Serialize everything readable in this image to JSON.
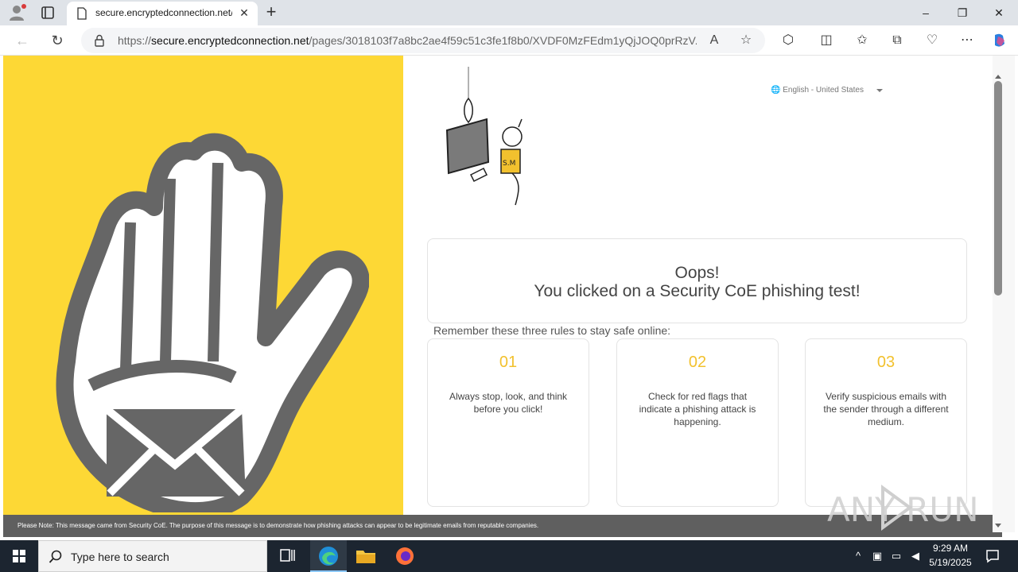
{
  "browser": {
    "tab_title": "secure.encryptedconnection.net/",
    "tab_close": "✕",
    "new_tab": "+",
    "url_scheme": "https://",
    "url_host": "secure.encryptedconnection.net",
    "url_path": "/pages/3018103f7a8bc2ae4f59c51c3fe1f8b0/XVDF0MzFEdm1yQjJOQ0prRzV...",
    "window_controls": [
      "–",
      "❐",
      "✕"
    ],
    "icons": [
      "profile-icon",
      "tab-actions-icon",
      "page-icon",
      "lock-icon",
      "read-aloud-icon",
      "favorite-star-icon",
      "extensions-icon",
      "split-screen-icon",
      "favorites-icon",
      "collections-icon",
      "browser-essentials-icon",
      "more-icon",
      "copilot-icon"
    ]
  },
  "page": {
    "language": "🌐 English - United States",
    "oops_line1": "Oops!",
    "oops_line2": "You clicked on a Security CoE phishing test!",
    "rules_heading": "Remember these three rules to stay safe online:",
    "rules": [
      {
        "num": "01",
        "text": "Always stop, look, and think before you click!"
      },
      {
        "num": "02",
        "text": "Check for red flags that indicate a phishing attack is happening."
      },
      {
        "num": "03",
        "text": "Verify suspicious emails with the sender through a different medium."
      }
    ],
    "footer_note": "Please Note: This message came from Security CoE. The purpose of this message is to demonstrate how phishing attacks can appear to be legitimate emails from reputable companies.",
    "illustration_badge": "S.M",
    "watermark": "ANY RUN"
  },
  "colors": {
    "left_panel": "#fdd835",
    "hand_outline": "#666666",
    "rule_number": "#f2c12e",
    "footer_bg": "#5f5f5f"
  },
  "taskbar": {
    "search_placeholder": "Type here to search",
    "time": "9:29 AM",
    "date": "5/19/2025",
    "icons": [
      "windows-start-icon",
      "search-icon",
      "task-view-icon",
      "edge-icon",
      "file-explorer-icon",
      "firefox-icon",
      "tray-chevron-icon",
      "meet-now-icon",
      "network-icon",
      "volume-icon",
      "notification-icon"
    ]
  }
}
